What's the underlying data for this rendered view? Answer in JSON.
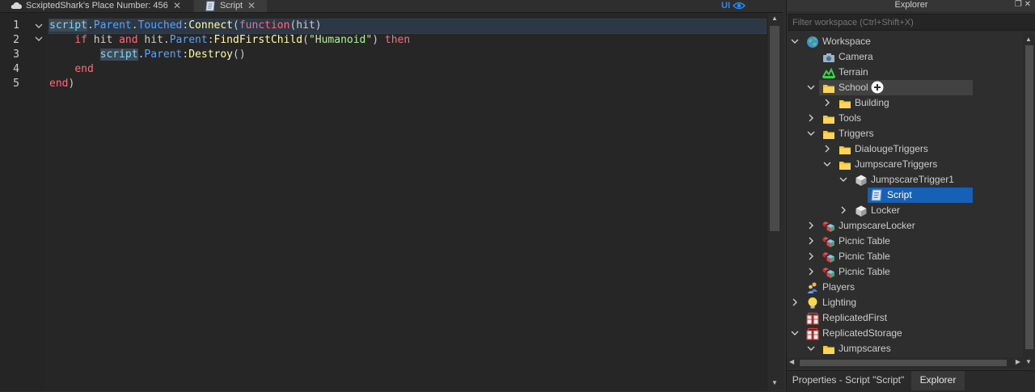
{
  "tabs": [
    {
      "label": "ScxiptedShark's Place Number: 456",
      "icon": "cloud-icon"
    },
    {
      "label": "Script",
      "icon": "script-icon",
      "active": true
    }
  ],
  "ui_toggle_label": "UI",
  "editor": {
    "line_numbers": [
      "1",
      "2",
      "3",
      "4",
      "5"
    ],
    "code_lines": [
      "script.Parent.Touched:Connect(function(hit)",
      "    if hit and hit.Parent:FindFirstChild(\"Humanoid\") then",
      "        script.Parent:Destroy()",
      "    end",
      "end)"
    ],
    "tokens": {
      "l1": [
        "script",
        ".",
        "Parent",
        ".",
        "Touched",
        ":",
        "Connect",
        "(",
        "function",
        "(hit)"
      ],
      "l2": [
        "    ",
        "if",
        " hit ",
        "and",
        " hit.",
        "Parent",
        ":",
        "FindFirstChild",
        "(",
        "\"Humanoid\"",
        ") ",
        "then"
      ],
      "l3": [
        "        ",
        "script",
        ".",
        "Parent",
        ":",
        "Destroy",
        "()"
      ],
      "l4": [
        "    ",
        "end"
      ],
      "l5": [
        "end",
        ")"
      ]
    }
  },
  "explorer": {
    "title": "Explorer",
    "filter_placeholder": "Filter workspace (Ctrl+Shift+X)",
    "tree": [
      {
        "label": "Workspace",
        "icon": "workspace-globe-icon",
        "chevron": "down"
      },
      {
        "label": "Camera",
        "icon": "camera-icon",
        "chevron": ""
      },
      {
        "label": "Terrain",
        "icon": "terrain-icon",
        "chevron": ""
      },
      {
        "label": "School",
        "icon": "folder-icon",
        "chevron": "down",
        "hovered": true,
        "insert_button": true
      },
      {
        "label": "Building",
        "icon": "folder-icon",
        "chevron": "right"
      },
      {
        "label": "Tools",
        "icon": "folder-icon",
        "chevron": "right"
      },
      {
        "label": "Triggers",
        "icon": "folder-icon",
        "chevron": "down"
      },
      {
        "label": "DialougeTriggers",
        "icon": "folder-icon",
        "chevron": "right"
      },
      {
        "label": "JumpscareTriggers",
        "icon": "folder-icon",
        "chevron": "down"
      },
      {
        "label": "JumpscareTrigger1",
        "icon": "part-icon",
        "chevron": "down"
      },
      {
        "label": "Script",
        "icon": "script-icon",
        "chevron": "",
        "selected": true
      },
      {
        "label": "Locker",
        "icon": "part-icon",
        "chevron": "right"
      },
      {
        "label": "JumpscareLocker",
        "icon": "model-icon",
        "chevron": "right"
      },
      {
        "label": "Picnic Table",
        "icon": "model-icon",
        "chevron": "right"
      },
      {
        "label": "Picnic Table",
        "icon": "model-icon",
        "chevron": "right"
      },
      {
        "label": "Picnic Table",
        "icon": "model-icon",
        "chevron": "right"
      },
      {
        "label": "Players",
        "icon": "players-icon",
        "chevron": ""
      },
      {
        "label": "Lighting",
        "icon": "lightbulb-icon",
        "chevron": "right"
      },
      {
        "label": "ReplicatedFirst",
        "icon": "replicated-icon",
        "chevron": ""
      },
      {
        "label": "ReplicatedStorage",
        "icon": "replicated-icon",
        "chevron": "down"
      },
      {
        "label": "Jumpscares",
        "icon": "folder-icon",
        "chevron": "down"
      }
    ]
  },
  "bottom_tabs": [
    {
      "label": "Properties - Script \"Script\""
    },
    {
      "label": "Explorer",
      "active": true
    }
  ],
  "colors": {
    "selection": "#1660b8",
    "hover": "#424242",
    "keyword": "#f86d7c",
    "builtin": "#84d6f7",
    "property": "#61a1f1",
    "function": "#fdfbac",
    "string": "#adf195"
  }
}
